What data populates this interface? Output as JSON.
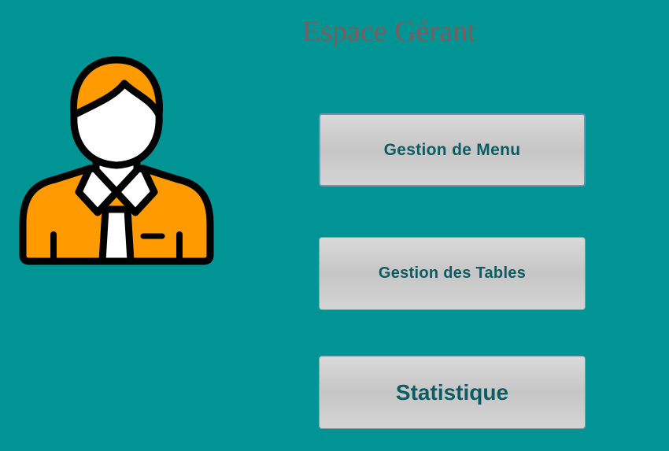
{
  "header": {
    "title": "Espace Gérant"
  },
  "avatar": {
    "icon": "manager-avatar-icon"
  },
  "buttons": {
    "menu_label": "Gestion de Menu",
    "tables_label": "Gestion des Tables",
    "stats_label": "Statistique"
  },
  "colors": {
    "background": "#009494",
    "title": "#7f5c5c",
    "button_text": "#0d5c63",
    "avatar_orange": "#ff9a00"
  }
}
